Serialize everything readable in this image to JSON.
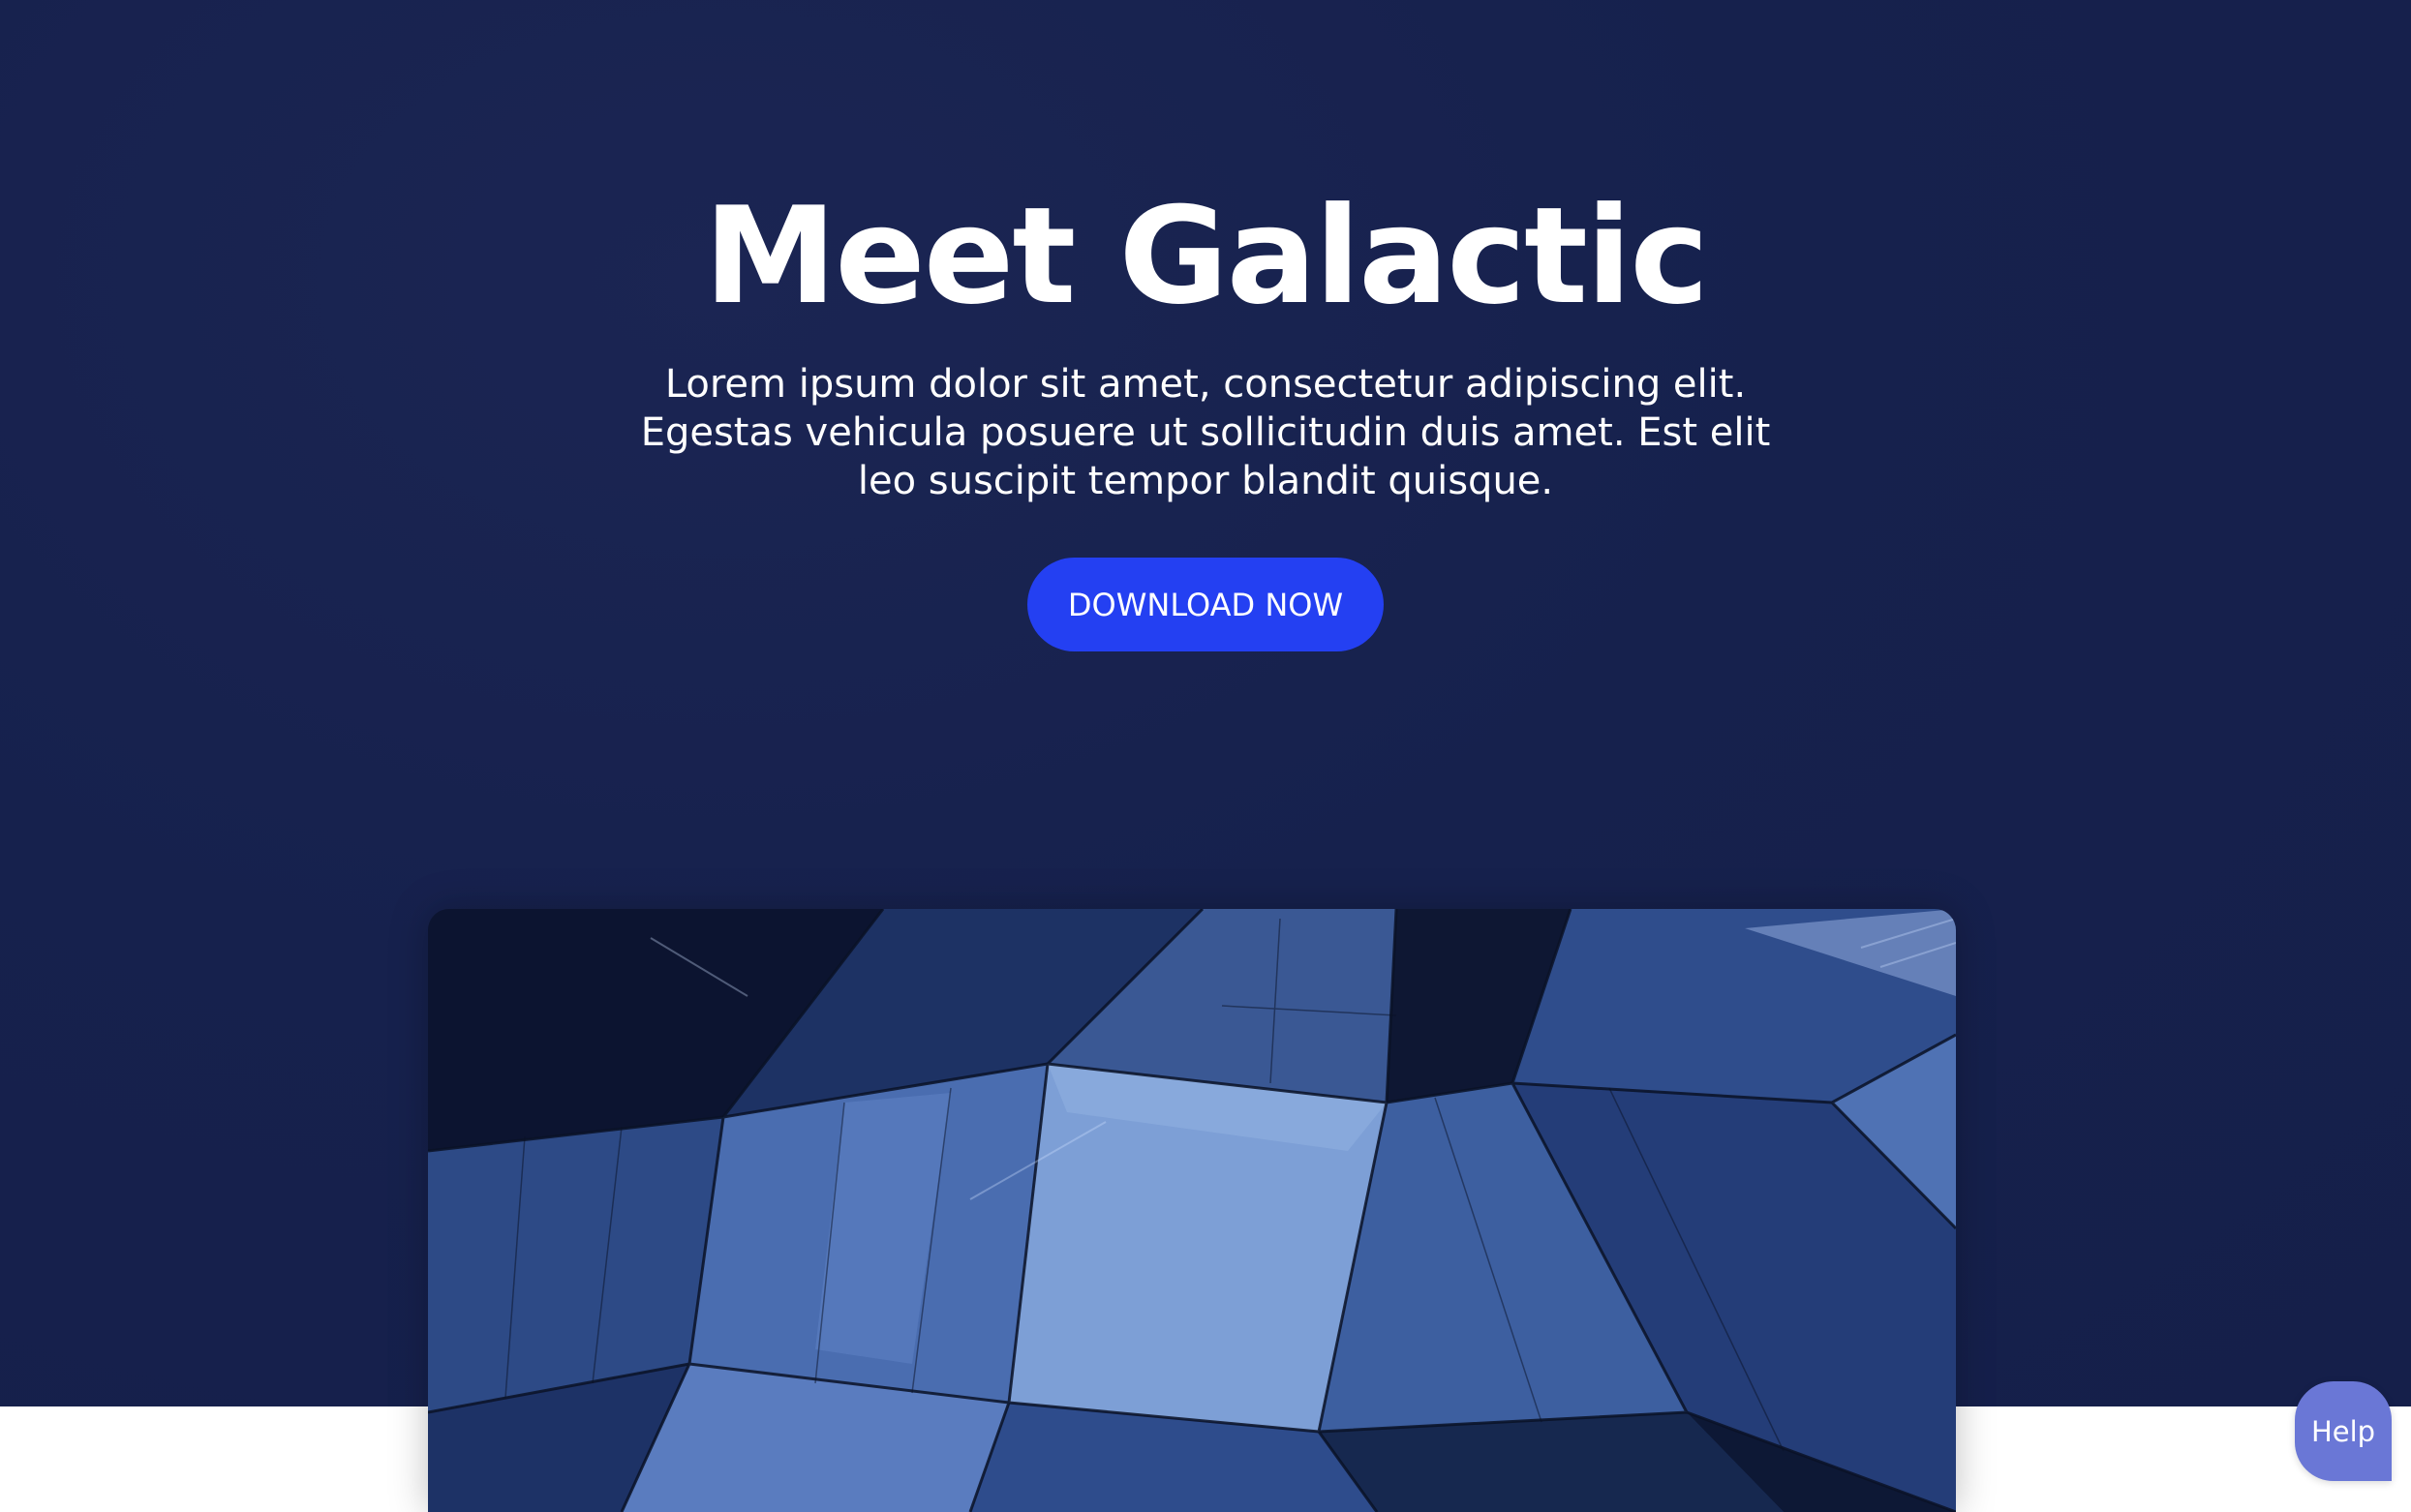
{
  "hero": {
    "title": "Meet Galactic",
    "subtitle": "Lorem ipsum dolor sit amet, consectetur adipiscing elit. Egestas vehicula posuere ut sollicitudin duis amet. Est elit leo suscipit tempor blandit quisque.",
    "cta_label": "DOWNLOAD NOW"
  },
  "media": {
    "image_icon": "architecture-image"
  },
  "help_widget": {
    "label": "Help"
  },
  "colors": {
    "hero_background": "#16214d",
    "cta_background": "#2440f2",
    "help_background": "#6a77d6",
    "text": "#ffffff"
  }
}
